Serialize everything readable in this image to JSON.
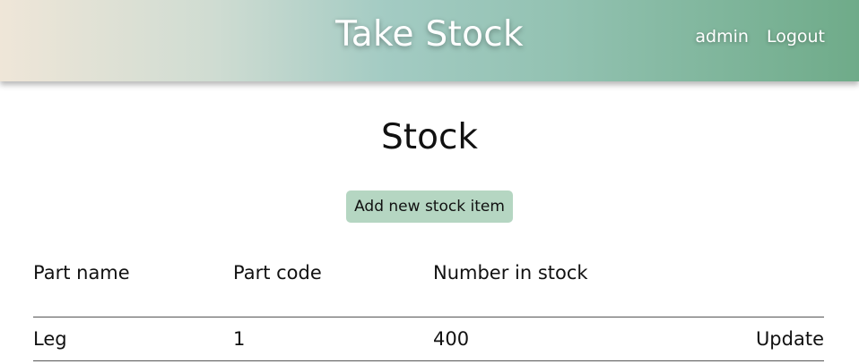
{
  "header": {
    "title": "Take Stock",
    "user": "admin",
    "logout": "Logout"
  },
  "main": {
    "page_title": "Stock",
    "add_button_label": "Add new stock item",
    "table": {
      "columns": [
        "Part name",
        "Part code",
        "Number in stock",
        ""
      ],
      "rows": [
        {
          "part_name": "Leg",
          "part_code": "1",
          "number_in_stock": "400",
          "action": "Update"
        }
      ]
    }
  }
}
